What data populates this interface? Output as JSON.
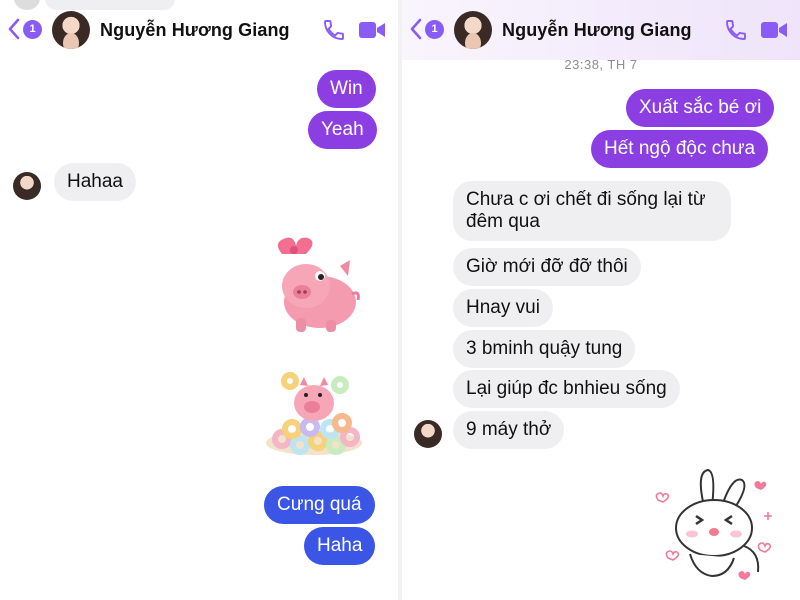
{
  "left_chat": {
    "header": {
      "contact_name": "Nguyễn Hương Giang",
      "unread_count": "1"
    },
    "messages": [
      {
        "from": "me",
        "text": "Win"
      },
      {
        "from": "me",
        "text": "Yeah"
      },
      {
        "from": "them",
        "text": "Hahaa"
      },
      {
        "from": "me",
        "sticker": "pig-with-bow-sticker"
      },
      {
        "from": "me",
        "sticker": "pig-on-donuts-sticker"
      },
      {
        "from": "me",
        "text": "Cưng quá"
      },
      {
        "from": "me",
        "text": "Haha"
      }
    ]
  },
  "right_chat": {
    "header": {
      "contact_name": "Nguyễn Hương Giang",
      "unread_count": "1"
    },
    "timestamp": "23:38, TH 7",
    "messages": [
      {
        "from": "me",
        "text": "Xuất sắc bé ơi"
      },
      {
        "from": "me",
        "text": "Hết ngộ độc chưa"
      },
      {
        "from": "them",
        "text": "Chưa c ơi chết đi sống lại từ đêm qua"
      },
      {
        "from": "them",
        "text": "Giờ mới đỡ đỡ thôi"
      },
      {
        "from": "them",
        "text": "Hnay vui"
      },
      {
        "from": "them",
        "text": "3 bminh quậy tung"
      },
      {
        "from": "them",
        "text": "Lại giúp đc bnhieu sống"
      },
      {
        "from": "them",
        "text": "9 máy thở"
      },
      {
        "from": "me",
        "sticker": "bunny-hearts-sticker"
      }
    ]
  },
  "colors": {
    "accent_purple": "#8b3fe3",
    "accent_blue": "#3b56e6",
    "icon_purple": "#8a5cf6",
    "incoming_bubble": "#efeff2"
  }
}
